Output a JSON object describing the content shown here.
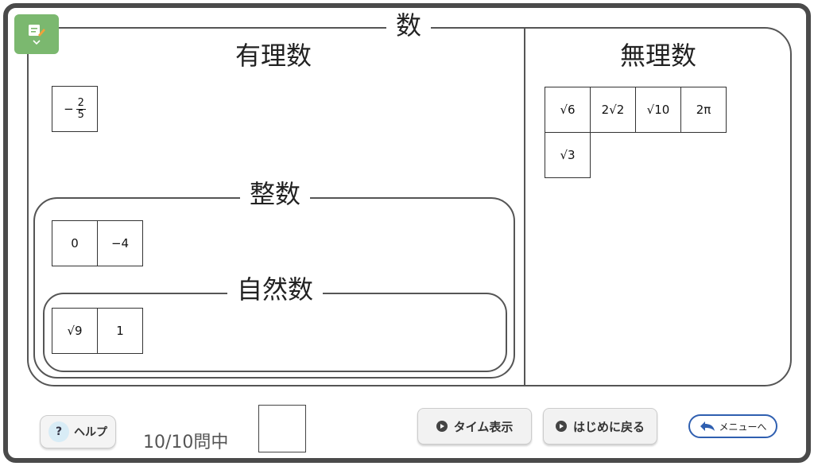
{
  "sets": {
    "all_label": "数",
    "rational_label": "有理数",
    "irrational_label": "無理数",
    "integer_label": "整数",
    "natural_label": "自然数"
  },
  "cards": {
    "rational": [
      {
        "kind": "frac",
        "sign": "−",
        "num": "2",
        "den": "5"
      }
    ],
    "integer": [
      {
        "kind": "text",
        "text": "0"
      },
      {
        "kind": "text",
        "text": "−4"
      }
    ],
    "natural": [
      {
        "kind": "text",
        "text": "√9"
      },
      {
        "kind": "text",
        "text": "1"
      }
    ],
    "irrational": [
      {
        "kind": "text",
        "text": "√6"
      },
      {
        "kind": "text",
        "text": "2√2"
      },
      {
        "kind": "text",
        "text": "√10"
      },
      {
        "kind": "text",
        "text": "2π"
      },
      {
        "kind": "text",
        "text": "√3"
      }
    ]
  },
  "footer": {
    "help_label": "ヘルプ",
    "help_symbol": "?",
    "progress_text": "10/10問中",
    "time_label": "タイム表示",
    "restart_label": "はじめに戻る",
    "menu_label": "メニューへ"
  },
  "colors": {
    "memo_button": "#7bb86f",
    "menu_border": "#2f5fb0"
  },
  "icons": {
    "memo": "memo-pencil-icon",
    "chevron": "chevron-down-icon",
    "back": "back-arrow-icon",
    "play": "play-circle-icon"
  }
}
